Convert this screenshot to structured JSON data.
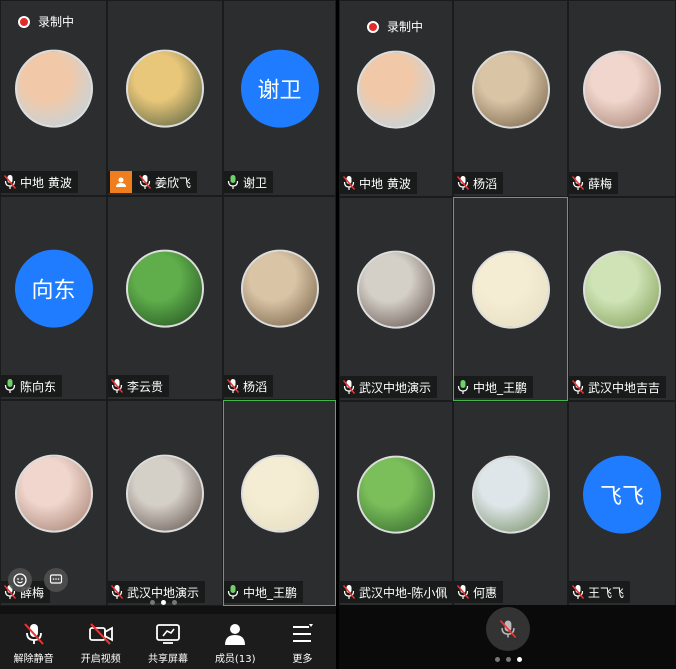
{
  "left": {
    "recording_label": "录制中",
    "cells": [
      {
        "name": "中地 黄波",
        "avatar_type": "photo",
        "bg": [
          "#f2c9a8",
          "#b7d6ea"
        ]
      },
      {
        "name": "姜欣飞",
        "avatar_type": "photo",
        "bg": [
          "#e9c77a",
          "#4c5a3c"
        ],
        "host": true
      },
      {
        "name": "谢卫",
        "avatar_type": "text",
        "avatar_text": "谢卫"
      },
      {
        "name": "陈向东",
        "avatar_type": "text",
        "avatar_text": "向东"
      },
      {
        "name": "李云贵",
        "avatar_type": "photo",
        "bg": [
          "#5fae4b",
          "#1f4a1f"
        ]
      },
      {
        "name": "杨滔",
        "avatar_type": "photo",
        "bg": [
          "#d9c4a6",
          "#6e5a40"
        ]
      },
      {
        "name": "薛梅",
        "avatar_type": "photo",
        "bg": [
          "#f0d6cd",
          "#a07a6a"
        ]
      },
      {
        "name": "武汉中地演示",
        "avatar_type": "photo",
        "bg": [
          "#d4cfc7",
          "#5b4c45"
        ]
      },
      {
        "name": "中地_王鹏",
        "avatar_type": "photo",
        "bg": [
          "#f4edd4",
          "#e6ddbf"
        ],
        "active": true
      }
    ],
    "toolbar": [
      {
        "label": "解除静音",
        "icon": "mic-muted-icon"
      },
      {
        "label": "开启视频",
        "icon": "video-off-icon"
      },
      {
        "label": "共享屏幕",
        "icon": "share-screen-icon"
      },
      {
        "label": "成员(13)",
        "icon": "members-icon"
      },
      {
        "label": "更多",
        "icon": "more-icon"
      }
    ]
  },
  "right": {
    "recording_label": "录制中",
    "cells": [
      {
        "name": "中地 黄波",
        "avatar_type": "photo",
        "bg": [
          "#f2c9a8",
          "#b7d6ea"
        ]
      },
      {
        "name": "杨滔",
        "avatar_type": "photo",
        "bg": [
          "#d9c4a6",
          "#6e5a40"
        ]
      },
      {
        "name": "薛梅",
        "avatar_type": "photo",
        "bg": [
          "#f0d6cd",
          "#a07a6a"
        ]
      },
      {
        "name": "武汉中地演示",
        "avatar_type": "photo",
        "bg": [
          "#d4cfc7",
          "#5b4c45"
        ]
      },
      {
        "name": "中地_王鹏",
        "avatar_type": "photo",
        "bg": [
          "#f4edd4",
          "#e6ddbf"
        ],
        "active": true
      },
      {
        "name": "武汉中地吉吉",
        "avatar_type": "photo",
        "bg": [
          "#cfe3b6",
          "#7a9a4f"
        ]
      },
      {
        "name": "武汉中地-陈小佩",
        "avatar_type": "photo",
        "bg": [
          "#7bbf5a",
          "#2d5f2a"
        ]
      },
      {
        "name": "何惠",
        "avatar_type": "photo",
        "bg": [
          "#dfe6ea",
          "#6f8a5c"
        ]
      },
      {
        "name": "王飞飞",
        "avatar_type": "text",
        "avatar_text": "飞飞"
      }
    ]
  },
  "colors": {
    "accent_blue": "#1f7cff",
    "active_border": "#3fb94a",
    "rec_red": "#e02b2b",
    "host_orange": "#f07d1e"
  }
}
